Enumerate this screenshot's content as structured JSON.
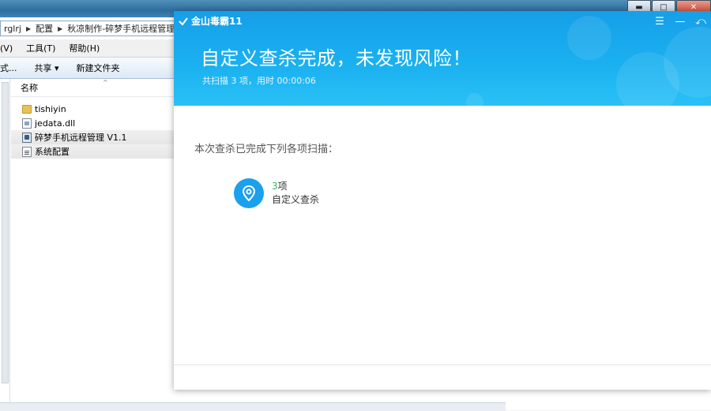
{
  "explorer": {
    "breadcrumbs": [
      "rglrj",
      "配置",
      "秋凉制作-碎梦手机远程管理"
    ],
    "menus": [
      "(V)",
      "工具(T)",
      "帮助(H)"
    ],
    "toolbar": {
      "left_cut": "式...",
      "share": "共享 ▾",
      "new_folder": "新建文件夹"
    },
    "column_header": "名称",
    "sort_caret": "^",
    "files": [
      {
        "name": "tishiyin",
        "icon": "folder-icon"
      },
      {
        "name": "jedata.dll",
        "icon": "dll-file-icon"
      },
      {
        "name": "碎梦手机远程管理 V1.1",
        "icon": "exe-file-icon"
      },
      {
        "name": "系统配置",
        "icon": "config-file-icon"
      }
    ]
  },
  "system_buttons": {
    "minimize": "▬",
    "maximize": "□",
    "close": "✕"
  },
  "antivirus": {
    "app_name": "金山毒霸11",
    "controls": {
      "menu": "☰",
      "minimize": "—",
      "back": "⤺"
    },
    "title": "自定义查杀完成，未发现风险！",
    "subtitle": "共扫描 3 项，用时 00:00:06",
    "summary": "本次查杀已完成下列各项扫描：",
    "item": {
      "count_number": "3",
      "count_unit": "项",
      "label": "自定义查杀",
      "icon": "location-pin-icon"
    }
  },
  "colors": {
    "accent": "#1aa0ec",
    "count_green": "#3bb65a"
  }
}
